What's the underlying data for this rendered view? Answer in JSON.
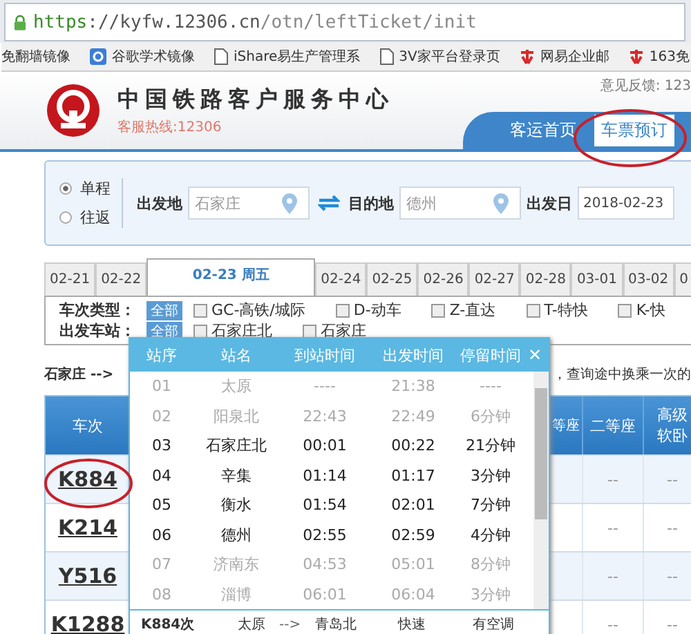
{
  "browser": {
    "url_scheme": "https",
    "url_host": "://kyfw.12306.cn",
    "url_path": "/otn/leftTicket/init",
    "bookmarks": [
      {
        "label": "免翻墙镜像",
        "kind": "none"
      },
      {
        "label": "谷歌学术镜像",
        "kind": "scholar"
      },
      {
        "label": "iShare易生产管理系",
        "kind": "page"
      },
      {
        "label": "3V家平台登录页",
        "kind": "page"
      },
      {
        "label": "网易企业邮",
        "kind": "netease"
      },
      {
        "label": "163免",
        "kind": "netease"
      }
    ]
  },
  "header": {
    "title": "中国铁路客户服务中心",
    "hotline": "客服热线:12306",
    "feedback": "意见反馈: 123",
    "nav": [
      {
        "label": "客运首页",
        "selected": false
      },
      {
        "label": "车票预订",
        "selected": true
      }
    ]
  },
  "search": {
    "trip_types": [
      {
        "label": "单程",
        "selected": true
      },
      {
        "label": "往返",
        "selected": false
      }
    ],
    "from_label": "出发地",
    "from_value": "石家庄",
    "to_label": "目的地",
    "to_value": "德州",
    "date_label": "出发日",
    "date_value": "2018-02-23"
  },
  "date_tabs": [
    {
      "label": "02-21",
      "selected": false
    },
    {
      "label": "02-22",
      "selected": false
    },
    {
      "label": "02-23 周五",
      "selected": true
    },
    {
      "label": "02-24",
      "selected": false
    },
    {
      "label": "02-25",
      "selected": false
    },
    {
      "label": "02-26",
      "selected": false
    },
    {
      "label": "02-27",
      "selected": false
    },
    {
      "label": "02-28",
      "selected": false
    },
    {
      "label": "03-01",
      "selected": false
    },
    {
      "label": "03-02",
      "selected": false
    },
    {
      "label": "0",
      "selected": false
    }
  ],
  "filters": [
    {
      "label": "车次类型：",
      "all": "全部",
      "options": [
        {
          "label": "GC-高铁/城际",
          "checked": false
        },
        {
          "label": "D-动车",
          "checked": false
        },
        {
          "label": "Z-直达",
          "checked": false
        },
        {
          "label": "T-特快",
          "checked": false
        },
        {
          "label": "K-快",
          "checked": false
        }
      ]
    },
    {
      "label": "出发车站：",
      "all": "全部",
      "options": [
        {
          "label": "石家庄北",
          "checked": false
        },
        {
          "label": "石家庄",
          "checked": false
        }
      ]
    }
  ],
  "route_text": "石家庄 -->",
  "transfer_text": "，查询途中换乘一次的",
  "table": {
    "columns": [
      "车次",
      "等座",
      "二等座",
      "高级软卧"
    ],
    "rows": [
      {
        "train": "K884",
        "cells": [
          "--",
          "--"
        ]
      },
      {
        "train": "K214",
        "cells": [
          "--",
          "--"
        ]
      },
      {
        "train": "Y516",
        "cells": [
          "--",
          "--"
        ]
      },
      {
        "train": "K1288",
        "cells": [
          "--",
          "--"
        ]
      }
    ]
  },
  "popup": {
    "columns": [
      "站序",
      "站名",
      "到站时间",
      "出发时间",
      "停留时间"
    ],
    "close": "✕",
    "stops": [
      {
        "no": "01",
        "station": "太原",
        "arrive": "----",
        "depart": "21:38",
        "stay": "----",
        "on_route": false
      },
      {
        "no": "02",
        "station": "阳泉北",
        "arrive": "22:43",
        "depart": "22:49",
        "stay": "6分钟",
        "on_route": false
      },
      {
        "no": "03",
        "station": "石家庄北",
        "arrive": "00:01",
        "depart": "00:22",
        "stay": "21分钟",
        "on_route": true
      },
      {
        "no": "04",
        "station": "辛集",
        "arrive": "01:14",
        "depart": "01:17",
        "stay": "3分钟",
        "on_route": true
      },
      {
        "no": "05",
        "station": "衡水",
        "arrive": "01:54",
        "depart": "02:01",
        "stay": "7分钟",
        "on_route": true
      },
      {
        "no": "06",
        "station": "德州",
        "arrive": "02:55",
        "depart": "02:59",
        "stay": "4分钟",
        "on_route": true
      },
      {
        "no": "07",
        "station": "济南东",
        "arrive": "04:53",
        "depart": "05:01",
        "stay": "8分钟",
        "on_route": false
      },
      {
        "no": "08",
        "station": "淄博",
        "arrive": "06:01",
        "depart": "06:04",
        "stay": "3分钟",
        "on_route": false
      }
    ],
    "footer": {
      "train": "K884次",
      "from": "太原",
      "arrow": "-->",
      "to": "青岛北",
      "type": "快速",
      "ac": "有空调"
    }
  }
}
